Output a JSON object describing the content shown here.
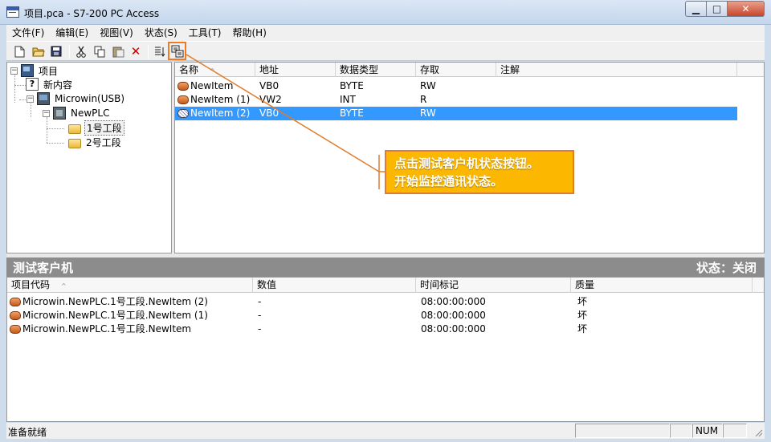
{
  "window": {
    "title": "项目.pca - S7-200 PC Access",
    "controls": {
      "minimize": "▁",
      "maximize": "□",
      "close": "✕"
    }
  },
  "menu": [
    "文件(F)",
    "编辑(E)",
    "视图(V)",
    "状态(S)",
    "工具(T)",
    "帮助(H)"
  ],
  "toolbar": {
    "icons": [
      "new-file-icon",
      "open-folder-icon",
      "save-icon",
      "cut-icon",
      "copy-icon",
      "paste-icon",
      "delete-icon",
      "sort-icon",
      "test-client-status-icon"
    ]
  },
  "tree": {
    "root": "项目",
    "new_content": "新内容",
    "connection": "Microwin(USB)",
    "plc": "NewPLC",
    "sections": [
      "1号工段",
      "2号工段"
    ]
  },
  "item_list": {
    "columns": [
      "名称",
      "地址",
      "数据类型",
      "存取",
      "注解"
    ],
    "sort_indicator": "^",
    "rows": [
      {
        "name": "NewItem",
        "address": "VB0",
        "type": "BYTE",
        "access": "RW",
        "comment": ""
      },
      {
        "name": "NewItem (1)",
        "address": "VW2",
        "type": "INT",
        "access": "R",
        "comment": ""
      },
      {
        "name": "NewItem (2)",
        "address": "VB0",
        "type": "BYTE",
        "access": "RW",
        "comment": ""
      }
    ]
  },
  "callout": {
    "line1": "点击测试客户机状态按钮。",
    "line2": "开始监控通讯状态。"
  },
  "test_client": {
    "title": "测试客户机",
    "status": "状态：关闭",
    "columns": [
      "项目代码",
      "数值",
      "时间标记",
      "质量"
    ],
    "sort_indicator": "^",
    "rows": [
      {
        "code": "Microwin.NewPLC.1号工段.NewItem (2)",
        "value": "-",
        "timestamp": "08:00:00:000",
        "quality": "坏"
      },
      {
        "code": "Microwin.NewPLC.1号工段.NewItem (1)",
        "value": "-",
        "timestamp": "08:00:00:000",
        "quality": "坏"
      },
      {
        "code": "Microwin.NewPLC.1号工段.NewItem",
        "value": "-",
        "timestamp": "08:00:00:000",
        "quality": "坏"
      }
    ]
  },
  "statusbar": {
    "text": "准备就绪",
    "num": "NUM"
  },
  "colors": {
    "selection": "#3399ff",
    "callout_fill": "#fcb800",
    "callout_border": "#e07c2a",
    "panel_bar": "#8c8c8c"
  }
}
